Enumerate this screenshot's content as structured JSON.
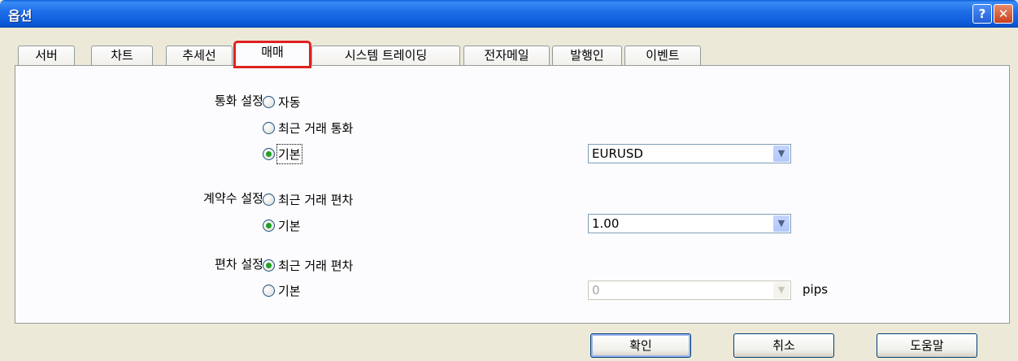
{
  "window": {
    "title": "옵션",
    "help_label": "?",
    "close_label": "✕"
  },
  "tabs": [
    {
      "label": "서버"
    },
    {
      "label": "차트"
    },
    {
      "label": "추세선"
    },
    {
      "label": "매매"
    },
    {
      "label": "시스템 트레이딩"
    },
    {
      "label": "전자메일"
    },
    {
      "label": "발행인"
    },
    {
      "label": "이벤트"
    }
  ],
  "active_tab": "매매",
  "currency": {
    "label": "통화 설정:",
    "options": [
      "자동",
      "최근 거래 통화",
      "기본"
    ],
    "selected": "기본",
    "default_value": "EURUSD"
  },
  "lots": {
    "label": "계약수 설정:",
    "options": [
      "최근 거래 편차",
      "기본"
    ],
    "selected": "기본",
    "default_value": "1.00"
  },
  "deviation": {
    "label": "편차 설정:",
    "options": [
      "최근 거래 편차",
      "기본"
    ],
    "selected": "최근 거래 편차",
    "default_value": "0",
    "unit": "pips"
  },
  "buttons": {
    "ok": "확인",
    "cancel": "취소",
    "help": "도움말"
  },
  "icons": {
    "dropdown": "chevron-down-icon"
  }
}
